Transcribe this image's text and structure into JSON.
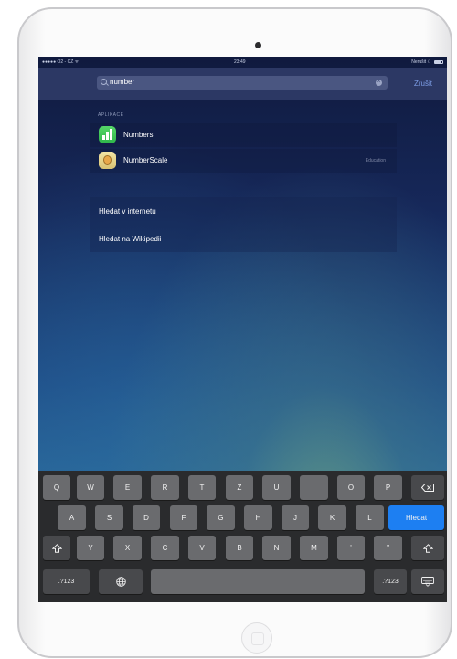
{
  "status_bar": {
    "carrier": "●●●●● O2 - CZ ᯤ",
    "time": "23:49",
    "right_label": "Nerušit ☾"
  },
  "search": {
    "query": "number",
    "cancel_label": "Zrušit"
  },
  "results": {
    "section_label": "APLIKACE",
    "apps": [
      {
        "name": "Numbers",
        "subtitle": ""
      },
      {
        "name": "NumberScale",
        "subtitle": "Education"
      }
    ],
    "web_actions": [
      {
        "label": "Hledat v internetu"
      },
      {
        "label": "Hledat na Wikipedii"
      }
    ]
  },
  "keyboard": {
    "row1": [
      "Q",
      "W",
      "E",
      "R",
      "T",
      "Z",
      "U",
      "I",
      "O",
      "P"
    ],
    "row2": [
      "A",
      "S",
      "D",
      "F",
      "G",
      "H",
      "J",
      "K",
      "L"
    ],
    "row3": [
      "Y",
      "X",
      "C",
      "V",
      "B",
      "N",
      "M",
      "'",
      "\""
    ],
    "numbers_label": ".?123",
    "numbers_label_right": ".?123",
    "return_label": "Hledat",
    "accent_color": "#1d7ff2"
  }
}
